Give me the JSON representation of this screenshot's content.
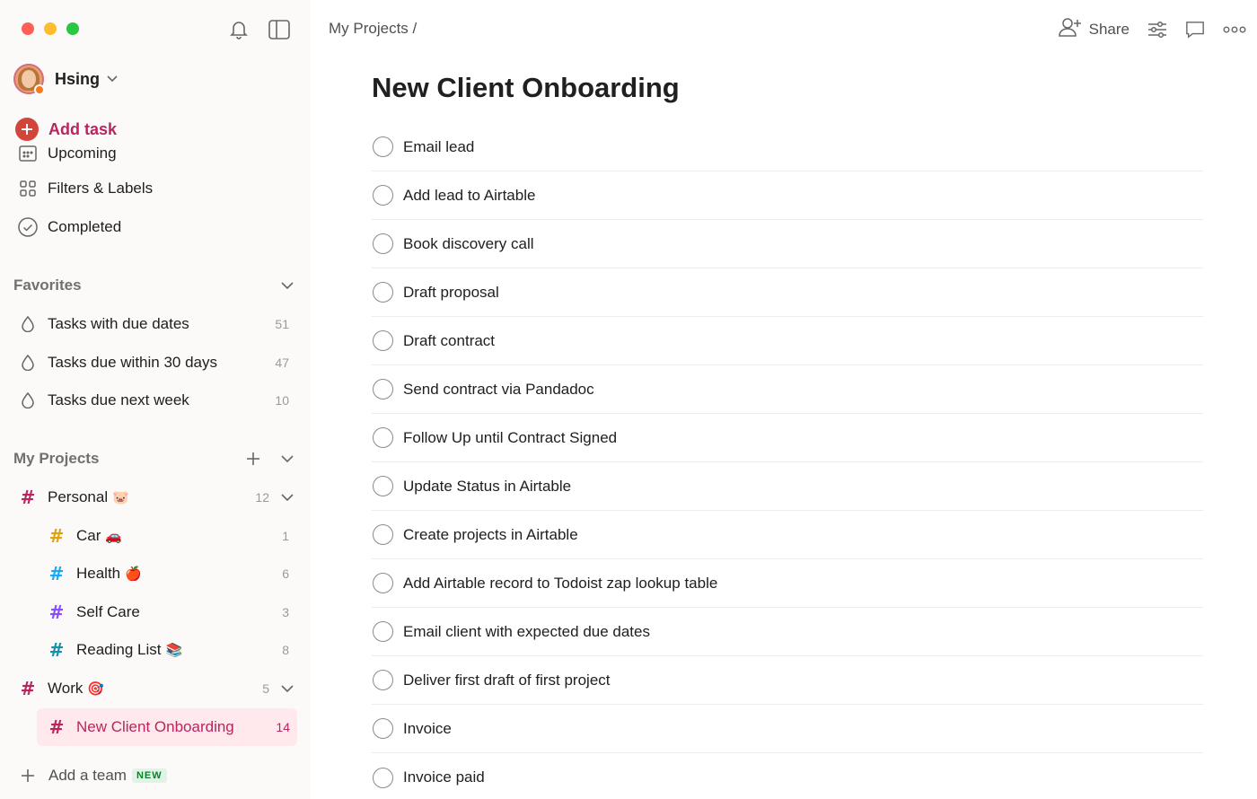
{
  "sidebar": {
    "user_name": "Hsing",
    "add_task_label": "Add task",
    "nav": {
      "upcoming": "Upcoming",
      "filters_labels": "Filters & Labels",
      "completed": "Completed"
    },
    "favorites": {
      "title": "Favorites",
      "items": [
        {
          "label": "Tasks with due dates",
          "count": "51"
        },
        {
          "label": "Tasks due within 30 days",
          "count": "47"
        },
        {
          "label": "Tasks due next week",
          "count": "10"
        }
      ]
    },
    "projects": {
      "title": "My Projects",
      "personal": {
        "label": "Personal",
        "emoji": "🐷",
        "count": "12"
      },
      "car": {
        "label": "Car",
        "emoji": "🚗",
        "count": "1"
      },
      "health": {
        "label": "Health",
        "emoji": "🍎",
        "count": "6"
      },
      "self_care": {
        "label": "Self Care",
        "count": "3"
      },
      "reading_list": {
        "label": "Reading List",
        "emoji": "📚",
        "count": "8"
      },
      "work": {
        "label": "Work",
        "emoji": "🎯",
        "count": "5"
      },
      "new_client": {
        "label": "New Client Onboarding",
        "count": "14"
      }
    },
    "add_team_label": "Add a team",
    "add_team_badge": "NEW"
  },
  "header": {
    "breadcrumb": "My Projects",
    "breadcrumb_sep": "/",
    "share_label": "Share"
  },
  "main": {
    "title": "New Client Onboarding",
    "tasks": [
      "Email lead",
      "Add lead to Airtable",
      "Book discovery call",
      "Draft proposal",
      "Draft contract",
      "Send contract via Pandadoc",
      "Follow Up until Contract Signed",
      "Update Status in Airtable",
      "Create projects in Airtable",
      "Add Airtable record to Todoist zap lookup table",
      "Email client with expected due dates",
      "Deliver first draft of first project",
      "Invoice",
      "Invoice paid"
    ]
  },
  "colors": {
    "accent": "#b8255f",
    "add_button": "#d1453b",
    "active_bg": "#ffe9ec",
    "hash_personal": "#b8255f",
    "hash_car": "#e0a30e",
    "hash_health": "#14aaf5",
    "hash_self_care": "#884dff",
    "hash_reading": "#158fad",
    "hash_work": "#b8255f"
  }
}
